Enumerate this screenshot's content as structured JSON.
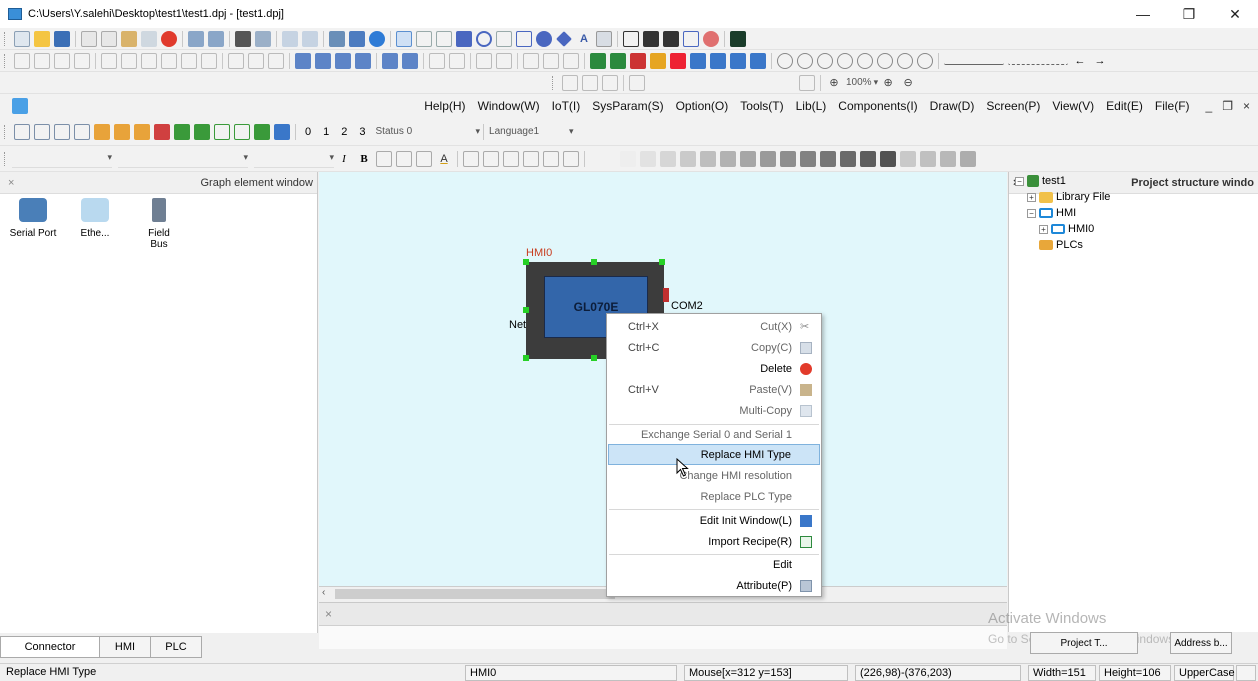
{
  "window": {
    "title": "C:\\Users\\Y.salehi\\Desktop\\test1\\test1.dpj - [test1.dpj]",
    "minimize": "—",
    "restore": "❐",
    "close": "✕"
  },
  "toolbar3": {
    "zoom": "100%"
  },
  "menubar": {
    "items": [
      "Help(H)",
      "Window(W)",
      "IoT(I)",
      "SysParam(S)",
      "Option(O)",
      "Tools(T)",
      "Lib(L)",
      "Components(I)",
      "Draw(D)",
      "Screen(P)",
      "View(V)",
      "Edit(E)",
      "File(F)"
    ],
    "mdi_min": "_",
    "mdi_restore": "❐",
    "mdi_close": "×"
  },
  "toolbar5": {
    "nums": [
      "0",
      "1",
      "2",
      "3"
    ],
    "status": "Status 0",
    "language": "Language1"
  },
  "graph_window": {
    "close": "×",
    "title": "Graph element window",
    "items": [
      {
        "label": "Serial Port",
        "icon": "serial-port-icon"
      },
      {
        "label": "Ethe...",
        "icon": "ethernet-icon"
      },
      {
        "label": "Field Bus",
        "icon": "field-bus-icon"
      }
    ]
  },
  "left_tabs": [
    "Connector",
    "HMI",
    "PLC"
  ],
  "canvas": {
    "hmi_label": "HMI0",
    "screen_text": "GL070E",
    "com_label": "COM2",
    "net_label": "Net"
  },
  "context_menu": {
    "items": [
      {
        "shortcut": "Ctrl+X",
        "label": "Cut(X)",
        "icon": "scissors-icon",
        "disabled": true
      },
      {
        "shortcut": "Ctrl+C",
        "label": "Copy(C)",
        "icon": "copy-icon",
        "disabled": true
      },
      {
        "shortcut": "",
        "label": "Delete",
        "icon": "delete-icon",
        "disabled": false
      },
      {
        "shortcut": "Ctrl+V",
        "label": "Paste(V)",
        "icon": "paste-icon",
        "disabled": true
      },
      {
        "shortcut": "",
        "label": "Multi-Copy",
        "icon": "multi-copy-icon",
        "disabled": true
      },
      {
        "shortcut": "",
        "label": "Exchange Serial 0 and Serial 1",
        "icon": "",
        "disabled": true
      },
      {
        "shortcut": "",
        "label": "Replace HMI Type",
        "icon": "",
        "disabled": false,
        "highlighted": true
      },
      {
        "shortcut": "",
        "label": "Change HMI resolution",
        "icon": "",
        "disabled": true
      },
      {
        "shortcut": "",
        "label": "Replace PLC Type",
        "icon": "",
        "disabled": true
      },
      {
        "shortcut": "",
        "label": "Edit Init Window(L)",
        "icon": "init-window-icon",
        "disabled": false
      },
      {
        "shortcut": "",
        "label": "Import Recipe(R)",
        "icon": "recipe-icon",
        "disabled": false
      },
      {
        "shortcut": "",
        "label": "Edit",
        "icon": "",
        "disabled": false
      },
      {
        "shortcut": "",
        "label": "Attribute(P)",
        "icon": "attribute-icon",
        "disabled": false
      }
    ]
  },
  "project_window": {
    "close": "×",
    "title": "Project structure windo",
    "tree": [
      {
        "label": "test1",
        "toggle": "−"
      },
      {
        "label": "Library File",
        "toggle": "+"
      },
      {
        "label": "HMI",
        "toggle": "−"
      },
      {
        "label": "HMI0",
        "toggle": "+"
      },
      {
        "label": "PLCs",
        "toggle": ""
      }
    ]
  },
  "right_tabs": [
    "Project T...",
    "Address b..."
  ],
  "watermark": {
    "line1": "Activate Windows",
    "line2": "Go to Settings to activate Windows."
  },
  "statusbar": {
    "hint": "Replace HMI Type",
    "object": "HMI0",
    "mouse": "Mouse[x=312  y=153]",
    "rect": "(226,98)-(376,203)",
    "width": "Width=151",
    "height": "Height=106",
    "case": "UpperCase"
  }
}
